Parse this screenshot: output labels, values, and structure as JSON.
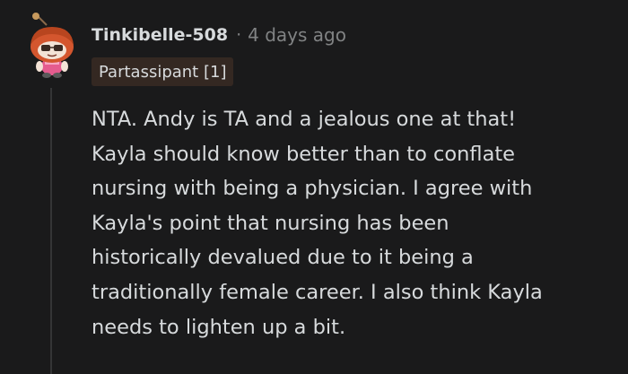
{
  "comment": {
    "username": "Tinkibelle-508",
    "separator": "·",
    "timestamp": "4 days ago",
    "flair": "Partassipant [1]",
    "body_lines": [
      "NTA. Andy is TA and a jealous one at that!",
      "Kayla should know better than to conflate",
      "nursing with being a physician. I agree with",
      "Kayla's point that nursing has been",
      "historically devalued due to it being a",
      "traditionally female career. I also think Kayla",
      "needs to lighten up a bit."
    ]
  },
  "icons": {
    "avatar": "snoo-avatar-icon"
  },
  "colors": {
    "background": "#1a1a1b",
    "text": "#d7dadc",
    "muted": "#818384",
    "flair_bg": "#342822",
    "thread_line": "#343536"
  }
}
